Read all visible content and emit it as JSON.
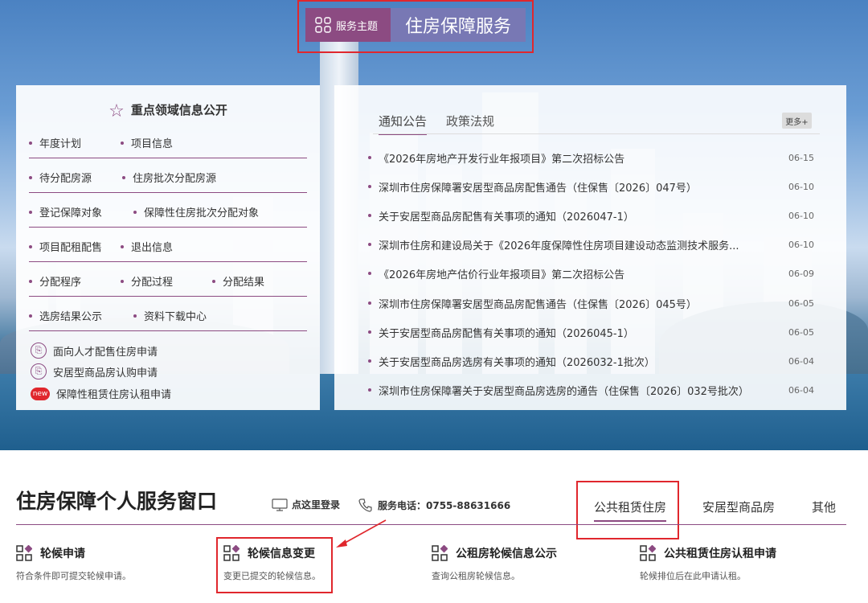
{
  "header": {
    "badge_left_label": "服务主题",
    "badge_right_label": "住房保障服务"
  },
  "left_panel": {
    "title": "重点领域信息公开",
    "rows": [
      [
        "年度计划",
        "项目信息"
      ],
      [
        "待分配房源",
        "住房批次分配房源"
      ],
      [
        "登记保障对象",
        "保障性住房批次分配对象"
      ],
      [
        "项目配租配售",
        "退出信息"
      ],
      [
        "分配程序",
        "分配过程",
        "分配结果"
      ],
      [
        "选房结果公示",
        "资料下载中心"
      ]
    ],
    "applications": [
      {
        "label": "面向人才配售住房申请",
        "icon": "document-circle-icon"
      },
      {
        "label": "安居型商品房认购申请",
        "icon": "document-circle-icon"
      },
      {
        "label": "保障性租赁住房认租申请",
        "icon": "new-badge-icon",
        "badge": "new"
      }
    ]
  },
  "right_panel": {
    "tabs": [
      "通知公告",
      "政策法规"
    ],
    "more_label": "更多+",
    "news": [
      {
        "title": "《2026年房地产开发行业年报项目》第二次招标公告",
        "date": "06-15"
      },
      {
        "title": "深圳市住房保障署安居型商品房配售通告（住保售〔2026〕047号）",
        "date": "06-10"
      },
      {
        "title": "关于安居型商品房配售有关事项的通知（2026047-1）",
        "date": "06-10"
      },
      {
        "title": "深圳市住房和建设局关于《2026年度保障性住房项目建设动态监测技术服务...",
        "date": "06-10"
      },
      {
        "title": "《2026年房地产估价行业年报项目》第二次招标公告",
        "date": "06-09"
      },
      {
        "title": "深圳市住房保障署安居型商品房配售通告（住保售〔2026〕045号）",
        "date": "06-05"
      },
      {
        "title": "关于安居型商品房配售有关事项的通知（2026045-1）",
        "date": "06-05"
      },
      {
        "title": "关于安居型商品房选房有关事项的通知（2026032-1批次）",
        "date": "06-04"
      },
      {
        "title": "深圳市住房保障署关于安居型商品房选房的通告（住保售〔2026〕032号批次）",
        "date": "06-04"
      }
    ]
  },
  "service_window": {
    "title": "住房保障个人服务窗口",
    "login_label": "点这里登录",
    "phone_label": "服务电话：0755-88631666",
    "tabs": [
      "公共租赁住房",
      "安居型商品房",
      "其他"
    ],
    "services": [
      {
        "title": "轮候申请",
        "desc": "符合条件即可提交轮候申请。"
      },
      {
        "title": "轮候信息变更",
        "desc": "变更已提交的轮候信息。"
      },
      {
        "title": "公租房轮候信息公示",
        "desc": "查询公租房轮候信息。"
      },
      {
        "title": "公共租赁住房认租申请",
        "desc": "轮候排位后在此申请认租。"
      }
    ]
  },
  "colors": {
    "accent": "#8c4b82",
    "badge_right": "#7878b4",
    "highlight": "#e0272d"
  }
}
